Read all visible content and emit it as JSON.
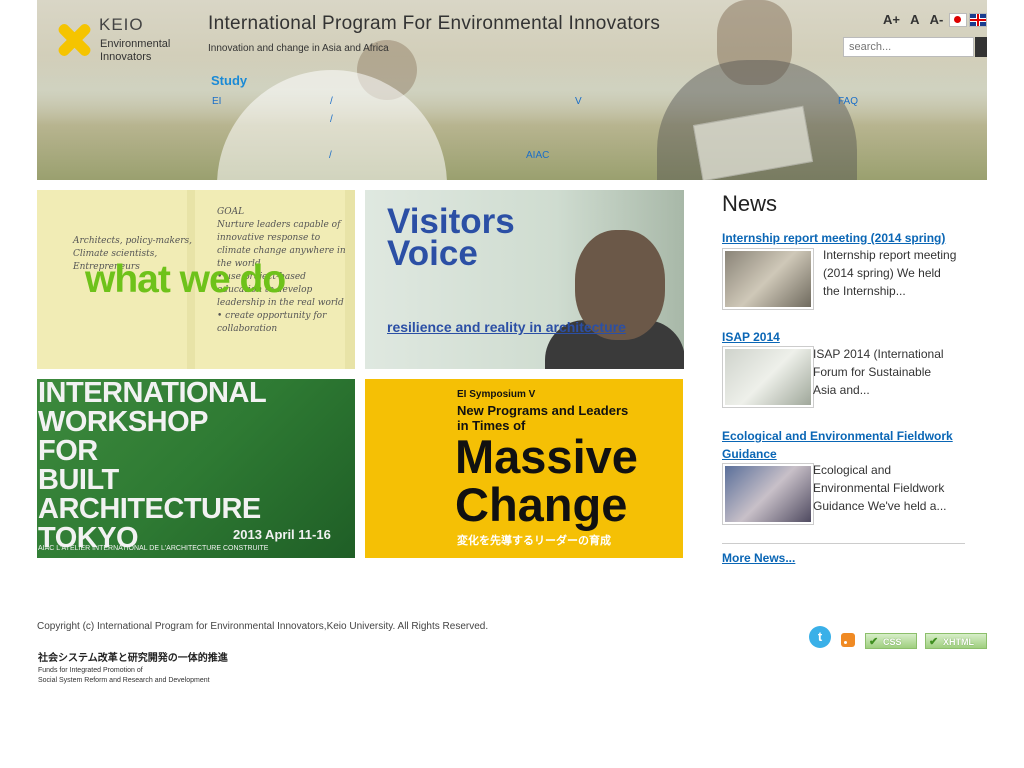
{
  "header": {
    "logo_keio": "KEIO",
    "logo_line1": "Environmental",
    "logo_line2": "Innovators",
    "site_title": "International Program For Environmental Innovators",
    "site_subtitle": "Innovation and change in Asia and Africa",
    "font_sizes": [
      "A+",
      "A",
      "A-"
    ],
    "languages": [
      "jp-flag",
      "en-flag"
    ],
    "search_placeholder": "search..."
  },
  "nav": {
    "study": "Study",
    "items": [
      "EI",
      "/",
      "/",
      "V",
      "FAQ",
      "/",
      "AIAC"
    ]
  },
  "tiles": {
    "what_we_do": {
      "title": "what we do",
      "notes_left": "Architects, policy-makers, Climate scientists, Entrepreneurs",
      "notes_right": "GOAL\nNurture leaders capable of innovative response to climate change anywhere in the world\n• use project-based education to develop leadership in the real world\n• create opportunity for collaboration"
    },
    "visitors_voice": {
      "title_line1": "Visitors",
      "title_line2": "Voice",
      "subtitle": "resilience and reality in architecture"
    },
    "workshop": {
      "lines": [
        "INTERNATIONAL",
        "WORKSHOP",
        "FOR",
        "BUILT",
        "ARCHITECTURE",
        "TOKYO"
      ],
      "date": "2013 April 11-16",
      "footer": "AIAC  L'ATELIER INTERNATIONAL DE L'ARCHITECTURE CONSTRUITE"
    },
    "symposium": {
      "label": "EI Symposium V",
      "line1": "New Programs and Leaders",
      "line2": "in Times of",
      "big1": "Massive",
      "big2": "Change",
      "japanese": "変化を先導するリーダーの育成"
    }
  },
  "news": {
    "title": "News",
    "items": [
      {
        "headline": "Internship report meeting (2014 spring)",
        "excerpt": [
          "Internship report meeting",
          "(2014 spring) We held",
          "the Internship..."
        ]
      },
      {
        "headline": "ISAP 2014",
        "excerpt": [
          "ISAP 2014 (International",
          "Forum for Sustainable",
          "Asia and..."
        ]
      },
      {
        "headline_lines": [
          "Ecological and Environmental Fieldwork",
          "Guidance"
        ],
        "excerpt": [
          "Ecological and",
          "Environmental Fieldwork",
          "Guidance We've held a..."
        ]
      }
    ],
    "more": "More News..."
  },
  "footer": {
    "copyright": "Copyright (c) International Program for Environmental Innovators,Keio University. All Rights Reserved.",
    "fund_jp": "社会システム改革と研究開発の一体的推進",
    "fund_en1": "Funds for Integrated Promotion of",
    "fund_en2": "Social System Reform and Research and Development",
    "badge_css": "CSS",
    "badge_xhtml": "XHTML",
    "twitter_glyph": "t"
  },
  "colors": {
    "accent_yellow": "#f5c400",
    "link_blue": "#0a66b5",
    "tile_green": "#6ec21a",
    "symposium_yellow": "#f5c005"
  }
}
